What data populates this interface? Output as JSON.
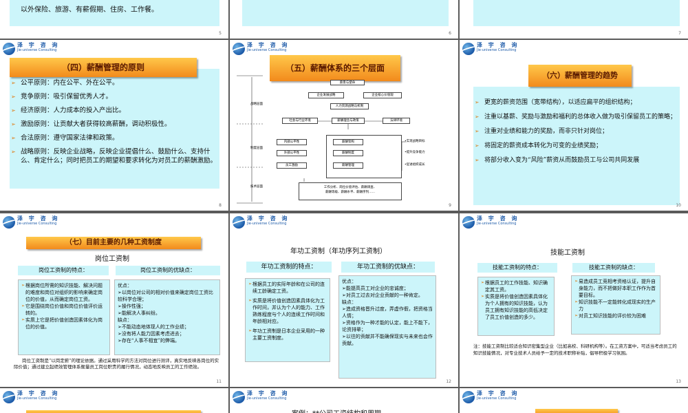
{
  "slide_top": {
    "left_text": "以外保险、旅游、有薪假期、住房、工作餐。",
    "page_left": "5",
    "page_mid": "6",
    "page_right": "7"
  },
  "logo": {
    "cn": "泽 宇 咨 询",
    "en": "Jie-universe Consulting"
  },
  "slide8": {
    "title": "（四）薪酬管理的原则",
    "items": [
      "公平原则：内在公平、外在公平。",
      "竞争原则：吸引保留优秀人才。",
      "经济原则：人力成本的投入产出比。",
      "激励原则：让贡献大者获得较高薪酬，调动积极性。",
      "合法原则：遵守国家法律和政策。",
      "战略原则：反映企业战略，反映企业提倡什么、鼓励什么、支持什么、肯定什么；同时把员工的期望和要求转化为对员工的薪酬激励。"
    ],
    "page": "8"
  },
  "slide9": {
    "title": "（五）薪酬体系的三个层面",
    "layers": [
      "战略层面",
      "制度层面",
      "技术层面"
    ],
    "boxes": {
      "top": "愿景与使命",
      "strategy": "企业发展战略",
      "values": "企业核心价值观",
      "hr": "人力资源战略与机制",
      "env": "社会与行业环境",
      "philosophy": "薪酬理念与政策",
      "law": "法律环境",
      "internal": "内部公平性",
      "external": "外部公平性",
      "incentive": "员工激励",
      "structure": "薪酬架构",
      "system": "薪酬制度",
      "management": "薪酬管理",
      "goal1": "•实现战略目标",
      "goal2": "•提升竞争能力",
      "goal3": "•促进组织成长",
      "bottom1": "工作分析、岗位价值评估、薪酬调查、",
      "bottom2": "薪酬等级、薪酬水平、薪酬序列……"
    },
    "page": "9"
  },
  "slide10": {
    "title": "（六）薪酬管理的趋势",
    "items": [
      "更宽的薪资范围（宽带结构），以适应扁平的组织结构；",
      "注重以基薪、奖励与激励和福利的总体收入做为吸引保留员工的策略；",
      "注重对业绩和能力的奖励，而非只针对岗位；",
      "将固定的薪资成本转化为可变的业绩奖励；",
      "将部分收入变为“风险”薪资从而鼓励员工与公司共同发展"
    ],
    "page": "10"
  },
  "slide11": {
    "title": "（七）目前主要的几种工资制度",
    "subtitle": "岗位工资制",
    "head_left": "岗位工资制的特点：",
    "head_right": "岗位工资制的优缺点：",
    "left_items": [
      "根据岗位所需的知识技能、解决问题的难度和岗位对组织的影响来确定岗位的价值，从而确定岗位工资。",
      "它是围绕岗位价值和岗位价值评价运转的。",
      "实质上它是把价值创造因素体化为岗位的价值。"
    ],
    "right_text": "优点：\n➢以岗位对公司的相对价值来确定岗位工资比较科学合理；\n➢操作性强；\n➢能解决人事纠纷。\n缺点：\n➢不能动态地体现人的工作业绩；\n➢没有将人能力因素考虑进去；\n➢存在“人事不相宜”的弊端。",
    "note": "岗位工资制是“以岗定薪”的理论依据。通过采用科学的方法对岗位进行测评，真实地反映各岗位的实际价值；通过建立起绩效管理体系衡量员工岗位职责的履行情况，动态地反映员工的工作绩效。",
    "page": "11"
  },
  "slide12": {
    "title": "年功工资制（年功序列工资制）",
    "head_left": "年功工资制的特点：",
    "head_right": "年功工资制的优缺点：",
    "left_items": [
      "根据员工的实际年龄和在公司的连续工龄确定工资。",
      "实质是将价值创造因素具体化为工作时间，并认为个人的能力、工作熟练程度与个人的连续工作时间和年龄相对应。",
      "年功工资制是日本企业采用的一种主要工资制度。"
    ],
    "right_text": "优点：\n➢能提高员工对企业的忠诚度；\n➢对员工过去对企业贡献的一种肯定。\n缺点：\n➢造成资格晋升过度，弄虚作假，把资格当人情；\n➢资格作为一种才能的认定，能上不能下，论资排辈；\n➢以往的贡献并不能确保现实与未来也会作贡献。",
    "page": "12"
  },
  "slide13": {
    "title": "技能工资制",
    "head_left": "技能工资制的特点：",
    "head_right": "技能工资制的缺点：",
    "left_items": [
      "根据员工的工作技能、知识确定其工资。",
      "实质是将价值创造因素具体化为个人拥有的知识技能，认为员工拥有知识技能的高低决定了员工价值创造的多少。"
    ],
    "right_items": [
      "易造成员工竞相考资格认证，提升自身能力，而不把做好本职工作作为首要目标。",
      "知识技能不一定能转化成现实的生产力",
      "对员工知识技能的评价较为困难"
    ],
    "note": "注：技能工资制比较适合知识密集型企业（比如高校、科研机构等）。在工资方案中，可适当考虑员工的知识技能情况，对专业技术人员给予一定的技术职称补贴，倡导积极学习氛围。",
    "page": "13"
  },
  "slide_bottom": {
    "mid_title": "案例：**公司工资结构和周期"
  }
}
